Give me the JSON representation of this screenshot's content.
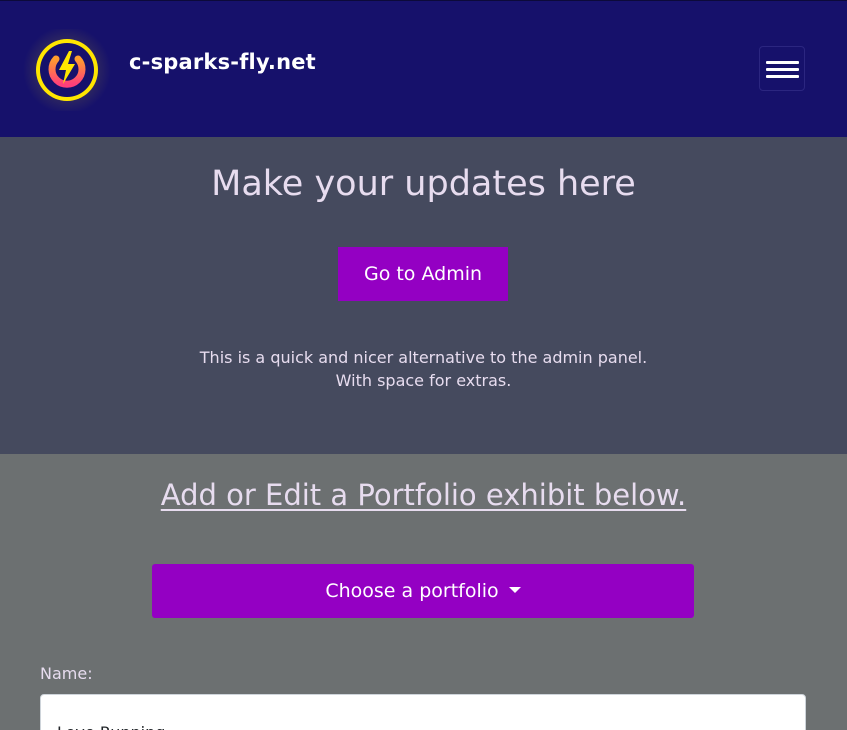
{
  "navbar": {
    "brand": "c-sparks-fly.net",
    "logo_icon": "power-lightning-icon",
    "menu_icon": "hamburger-menu-icon",
    "colors": {
      "background": "#16116b",
      "logo_ring": "#ffe600",
      "logo_fill": "#ff6a1a",
      "logo_bolt": "#ffe600"
    }
  },
  "hero": {
    "title": "Make your updates here",
    "admin_button": "Go to Admin",
    "description_line1": "This is a quick and nicer alternative to the admin panel.",
    "description_line2": "With space for extras.",
    "colors": {
      "background": "#454a5e",
      "button": "#9400c3"
    }
  },
  "portfolio": {
    "heading": "Add or Edit a Portfolio exhibit below.",
    "dropdown_label": "Choose a portfolio",
    "name_label": "Name:",
    "name_value": "Love Running",
    "colors": {
      "background": "#6c7071",
      "button": "#9400c3"
    }
  }
}
